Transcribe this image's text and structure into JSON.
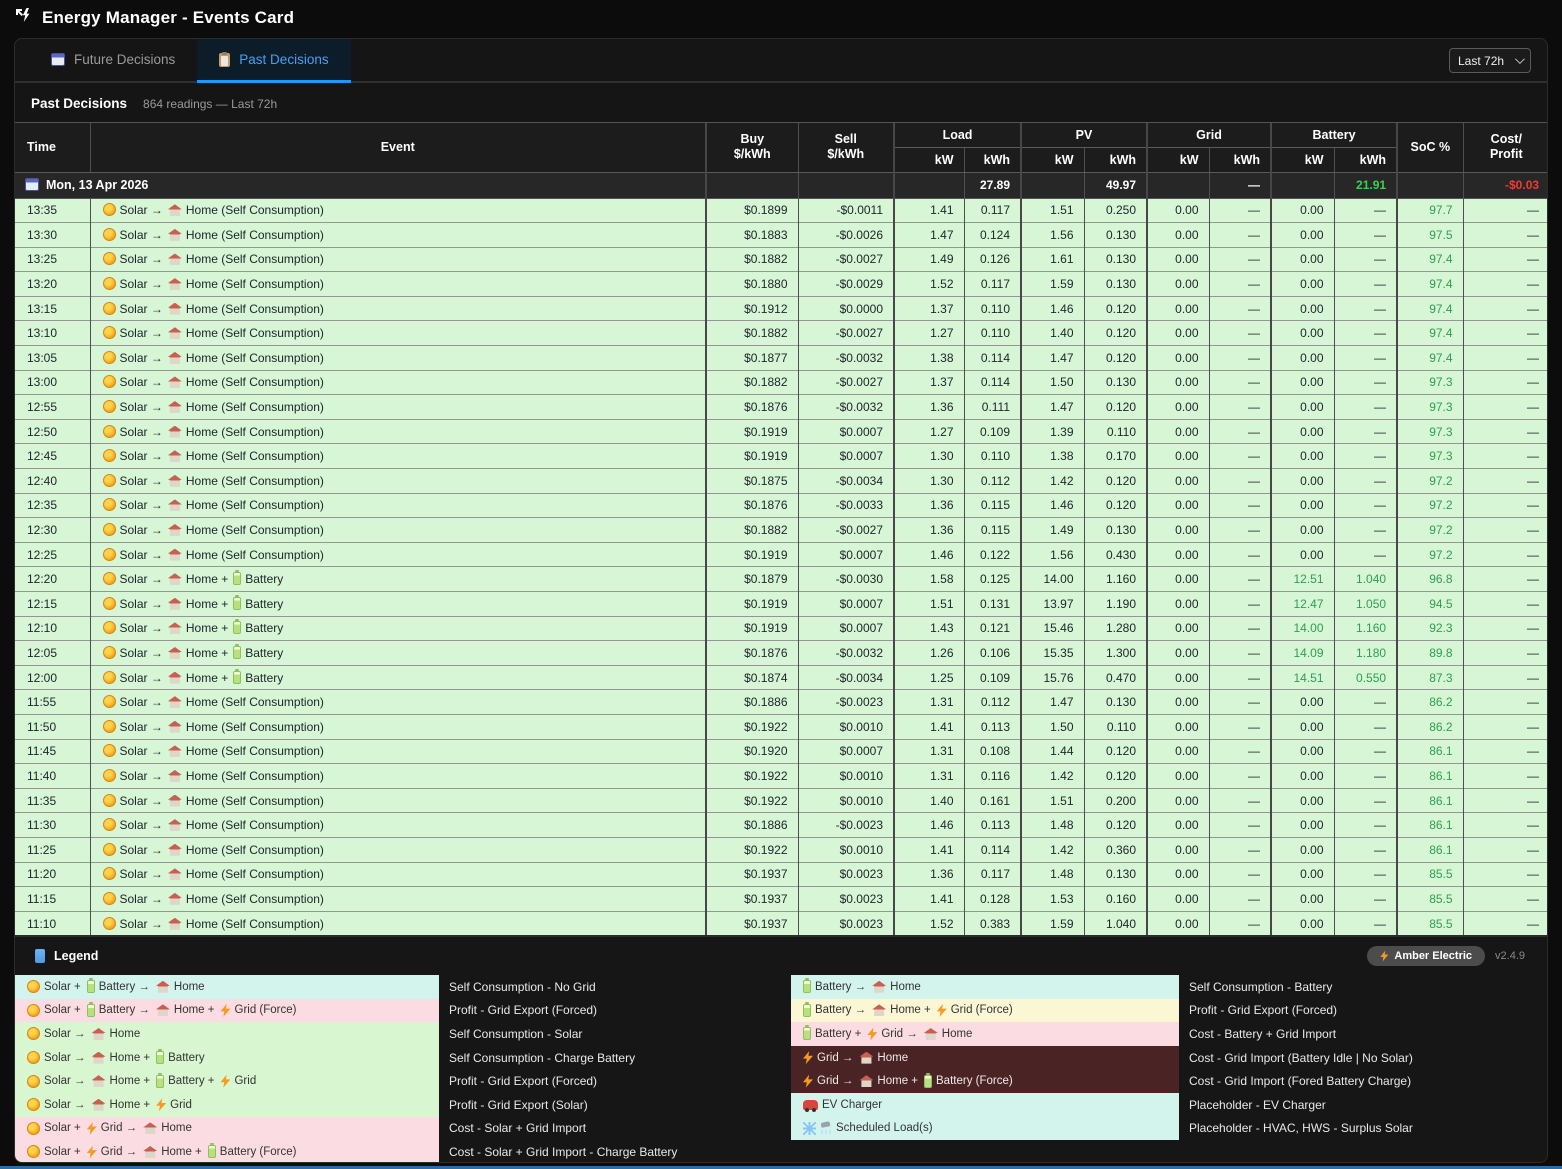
{
  "window": {
    "title": "Energy Manager - Events Card"
  },
  "tabs": [
    {
      "label": "Future Decisions",
      "icon": "calendar-icon",
      "active": false
    },
    {
      "label": "Past Decisions",
      "icon": "clipboard-icon",
      "active": true
    }
  ],
  "range_select": {
    "value": "Last 72h"
  },
  "section": {
    "title": "Past Decisions",
    "subtitle": "864 readings — Last 72h"
  },
  "table": {
    "headers": {
      "time": "Time",
      "event": "Event",
      "buy": "Buy",
      "sell": "Sell",
      "per_kwh": "$/kWh",
      "load": "Load",
      "pv": "PV",
      "grid": "Grid",
      "battery": "Battery",
      "kw": "kW",
      "kwh": "kWh",
      "soc": "SoC %",
      "cost_line1": "Cost/",
      "cost_line2": "Profit"
    },
    "date_row": {
      "date": "Mon, 13 Apr 2026",
      "load_kwh": "27.89",
      "pv_kwh": "49.97",
      "grid_kwh": "—",
      "battery_kwh": "21.91",
      "cost": "-$0.03"
    },
    "event_types": {
      "solar_self": {
        "tokens": [
          [
            "i",
            "sun"
          ],
          [
            "t",
            "Solar →"
          ],
          [
            "i",
            "home"
          ],
          [
            "t",
            "Home (Self Consumption)"
          ]
        ]
      },
      "solar_home_batt": {
        "tokens": [
          [
            "i",
            "sun"
          ],
          [
            "t",
            "Solar →"
          ],
          [
            "i",
            "home"
          ],
          [
            "t",
            "Home +"
          ],
          [
            "i",
            "battery"
          ],
          [
            "t",
            "Battery"
          ]
        ]
      }
    },
    "rows": [
      [
        "13:35",
        "solar_self",
        "$0.1899",
        "-$0.0011",
        "1.41",
        "0.117",
        "1.51",
        "0.250",
        "0.00",
        "—",
        "0.00",
        "—",
        "97.7",
        "—"
      ],
      [
        "13:30",
        "solar_self",
        "$0.1883",
        "-$0.0026",
        "1.47",
        "0.124",
        "1.56",
        "0.130",
        "0.00",
        "—",
        "0.00",
        "—",
        "97.5",
        "—"
      ],
      [
        "13:25",
        "solar_self",
        "$0.1882",
        "-$0.0027",
        "1.49",
        "0.126",
        "1.61",
        "0.130",
        "0.00",
        "—",
        "0.00",
        "—",
        "97.4",
        "—"
      ],
      [
        "13:20",
        "solar_self",
        "$0.1880",
        "-$0.0029",
        "1.52",
        "0.117",
        "1.59",
        "0.130",
        "0.00",
        "—",
        "0.00",
        "—",
        "97.4",
        "—"
      ],
      [
        "13:15",
        "solar_self",
        "$0.1912",
        "$0.0000",
        "1.37",
        "0.110",
        "1.46",
        "0.120",
        "0.00",
        "—",
        "0.00",
        "—",
        "97.4",
        "—"
      ],
      [
        "13:10",
        "solar_self",
        "$0.1882",
        "-$0.0027",
        "1.27",
        "0.110",
        "1.40",
        "0.120",
        "0.00",
        "—",
        "0.00",
        "—",
        "97.4",
        "—"
      ],
      [
        "13:05",
        "solar_self",
        "$0.1877",
        "-$0.0032",
        "1.38",
        "0.114",
        "1.47",
        "0.120",
        "0.00",
        "—",
        "0.00",
        "—",
        "97.4",
        "—"
      ],
      [
        "13:00",
        "solar_self",
        "$0.1882",
        "-$0.0027",
        "1.37",
        "0.114",
        "1.50",
        "0.130",
        "0.00",
        "—",
        "0.00",
        "—",
        "97.3",
        "—"
      ],
      [
        "12:55",
        "solar_self",
        "$0.1876",
        "-$0.0032",
        "1.36",
        "0.111",
        "1.47",
        "0.120",
        "0.00",
        "—",
        "0.00",
        "—",
        "97.3",
        "—"
      ],
      [
        "12:50",
        "solar_self",
        "$0.1919",
        "$0.0007",
        "1.27",
        "0.109",
        "1.39",
        "0.110",
        "0.00",
        "—",
        "0.00",
        "—",
        "97.3",
        "—"
      ],
      [
        "12:45",
        "solar_self",
        "$0.1919",
        "$0.0007",
        "1.30",
        "0.110",
        "1.38",
        "0.170",
        "0.00",
        "—",
        "0.00",
        "—",
        "97.3",
        "—"
      ],
      [
        "12:40",
        "solar_self",
        "$0.1875",
        "-$0.0034",
        "1.30",
        "0.112",
        "1.42",
        "0.120",
        "0.00",
        "—",
        "0.00",
        "—",
        "97.2",
        "—"
      ],
      [
        "12:35",
        "solar_self",
        "$0.1876",
        "-$0.0033",
        "1.36",
        "0.115",
        "1.46",
        "0.120",
        "0.00",
        "—",
        "0.00",
        "—",
        "97.2",
        "—"
      ],
      [
        "12:30",
        "solar_self",
        "$0.1882",
        "-$0.0027",
        "1.36",
        "0.115",
        "1.49",
        "0.130",
        "0.00",
        "—",
        "0.00",
        "—",
        "97.2",
        "—"
      ],
      [
        "12:25",
        "solar_self",
        "$0.1919",
        "$0.0007",
        "1.46",
        "0.122",
        "1.56",
        "0.430",
        "0.00",
        "—",
        "0.00",
        "—",
        "97.2",
        "—"
      ],
      [
        "12:20",
        "solar_home_batt",
        "$0.1879",
        "-$0.0030",
        "1.58",
        "0.125",
        "14.00",
        "1.160",
        "0.00",
        "—",
        "12.51",
        "1.040",
        "96.8",
        "—"
      ],
      [
        "12:15",
        "solar_home_batt",
        "$0.1919",
        "$0.0007",
        "1.51",
        "0.131",
        "13.97",
        "1.190",
        "0.00",
        "—",
        "12.47",
        "1.050",
        "94.5",
        "—"
      ],
      [
        "12:10",
        "solar_home_batt",
        "$0.1919",
        "$0.0007",
        "1.43",
        "0.121",
        "15.46",
        "1.280",
        "0.00",
        "—",
        "14.00",
        "1.160",
        "92.3",
        "—"
      ],
      [
        "12:05",
        "solar_home_batt",
        "$0.1876",
        "-$0.0032",
        "1.26",
        "0.106",
        "15.35",
        "1.300",
        "0.00",
        "—",
        "14.09",
        "1.180",
        "89.8",
        "—"
      ],
      [
        "12:00",
        "solar_home_batt",
        "$0.1874",
        "-$0.0034",
        "1.25",
        "0.109",
        "15.76",
        "0.470",
        "0.00",
        "—",
        "14.51",
        "0.550",
        "87.3",
        "—"
      ],
      [
        "11:55",
        "solar_self",
        "$0.1886",
        "-$0.0023",
        "1.31",
        "0.112",
        "1.47",
        "0.130",
        "0.00",
        "—",
        "0.00",
        "—",
        "86.2",
        "—"
      ],
      [
        "11:50",
        "solar_self",
        "$0.1922",
        "$0.0010",
        "1.41",
        "0.113",
        "1.50",
        "0.110",
        "0.00",
        "—",
        "0.00",
        "—",
        "86.2",
        "—"
      ],
      [
        "11:45",
        "solar_self",
        "$0.1920",
        "$0.0007",
        "1.31",
        "0.108",
        "1.44",
        "0.120",
        "0.00",
        "—",
        "0.00",
        "—",
        "86.1",
        "—"
      ],
      [
        "11:40",
        "solar_self",
        "$0.1922",
        "$0.0010",
        "1.31",
        "0.116",
        "1.42",
        "0.120",
        "0.00",
        "—",
        "0.00",
        "—",
        "86.1",
        "—"
      ],
      [
        "11:35",
        "solar_self",
        "$0.1922",
        "$0.0010",
        "1.40",
        "0.161",
        "1.51",
        "0.200",
        "0.00",
        "—",
        "0.00",
        "—",
        "86.1",
        "—"
      ],
      [
        "11:30",
        "solar_self",
        "$0.1886",
        "-$0.0023",
        "1.46",
        "0.113",
        "1.48",
        "0.120",
        "0.00",
        "—",
        "0.00",
        "—",
        "86.1",
        "—"
      ],
      [
        "11:25",
        "solar_self",
        "$0.1922",
        "$0.0010",
        "1.41",
        "0.114",
        "1.42",
        "0.360",
        "0.00",
        "—",
        "0.00",
        "—",
        "86.1",
        "—"
      ],
      [
        "11:20",
        "solar_self",
        "$0.1937",
        "$0.0023",
        "1.36",
        "0.117",
        "1.48",
        "0.130",
        "0.00",
        "—",
        "0.00",
        "—",
        "85.5",
        "—"
      ],
      [
        "11:15",
        "solar_self",
        "$0.1937",
        "$0.0023",
        "1.41",
        "0.128",
        "1.53",
        "0.160",
        "0.00",
        "—",
        "0.00",
        "—",
        "85.5",
        "—"
      ],
      [
        "11:10",
        "solar_self",
        "$0.1937",
        "$0.0023",
        "1.52",
        "0.383",
        "1.59",
        "1.040",
        "0.00",
        "—",
        "0.00",
        "—",
        "85.5",
        "—"
      ]
    ]
  },
  "legend": {
    "title": "Legend",
    "columns": [
      {
        "items": [
          {
            "color": "cyan",
            "desc": "Self Consumption - No Grid",
            "tokens": [
              [
                "i",
                "sun"
              ],
              [
                "t",
                "Solar +"
              ],
              [
                "i",
                "battery"
              ],
              [
                "t",
                "Battery →"
              ],
              [
                "i",
                "home"
              ],
              [
                "t",
                "Home"
              ]
            ]
          },
          {
            "color": "pink",
            "desc": "Profit - Grid Export (Forced)",
            "tokens": [
              [
                "i",
                "sun"
              ],
              [
                "t",
                "Solar +"
              ],
              [
                "i",
                "battery"
              ],
              [
                "t",
                "Battery →"
              ],
              [
                "i",
                "home"
              ],
              [
                "t",
                "Home +"
              ],
              [
                "i",
                "bolt"
              ],
              [
                "t",
                "Grid (Force)"
              ]
            ]
          },
          {
            "color": "green",
            "desc": "Self Consumption - Solar",
            "tokens": [
              [
                "i",
                "sun"
              ],
              [
                "t",
                "Solar →"
              ],
              [
                "i",
                "home"
              ],
              [
                "t",
                "Home"
              ]
            ]
          },
          {
            "color": "green",
            "desc": "Self Consumption - Charge Battery",
            "tokens": [
              [
                "i",
                "sun"
              ],
              [
                "t",
                "Solar →"
              ],
              [
                "i",
                "home"
              ],
              [
                "t",
                "Home +"
              ],
              [
                "i",
                "battery"
              ],
              [
                "t",
                "Battery"
              ]
            ]
          },
          {
            "color": "green",
            "desc": "Profit - Grid Export (Forced)",
            "tokens": [
              [
                "i",
                "sun"
              ],
              [
                "t",
                "Solar →"
              ],
              [
                "i",
                "home"
              ],
              [
                "t",
                "Home +"
              ],
              [
                "i",
                "battery"
              ],
              [
                "t",
                "Battery +"
              ],
              [
                "i",
                "bolt"
              ],
              [
                "t",
                "Grid"
              ]
            ]
          },
          {
            "color": "green",
            "desc": "Profit - Grid Export (Solar)",
            "tokens": [
              [
                "i",
                "sun"
              ],
              [
                "t",
                "Solar →"
              ],
              [
                "i",
                "home"
              ],
              [
                "t",
                "Home +"
              ],
              [
                "i",
                "bolt"
              ],
              [
                "t",
                "Grid"
              ]
            ]
          },
          {
            "color": "pink",
            "desc": "Cost - Solar + Grid Import",
            "tokens": [
              [
                "i",
                "sun"
              ],
              [
                "t",
                "Solar +"
              ],
              [
                "i",
                "bolt"
              ],
              [
                "t",
                "Grid →"
              ],
              [
                "i",
                "home"
              ],
              [
                "t",
                "Home"
              ]
            ]
          },
          {
            "color": "pink",
            "desc": "Cost - Solar + Grid Import - Charge Battery",
            "tokens": [
              [
                "i",
                "sun"
              ],
              [
                "t",
                "Solar +"
              ],
              [
                "i",
                "bolt"
              ],
              [
                "t",
                "Grid →"
              ],
              [
                "i",
                "home"
              ],
              [
                "t",
                "Home +"
              ],
              [
                "i",
                "battery"
              ],
              [
                "t",
                "Battery (Force)"
              ]
            ]
          }
        ]
      },
      {
        "items": [
          {
            "color": "cyan",
            "desc": "Self Consumption - Battery",
            "tokens": [
              [
                "i",
                "battery"
              ],
              [
                "t",
                "Battery →"
              ],
              [
                "i",
                "home"
              ],
              [
                "t",
                "Home"
              ]
            ]
          },
          {
            "color": "yellow",
            "desc": "Profit - Grid Export (Forced)",
            "tokens": [
              [
                "i",
                "battery"
              ],
              [
                "t",
                "Battery →"
              ],
              [
                "i",
                "home"
              ],
              [
                "t",
                "Home +"
              ],
              [
                "i",
                "bolt"
              ],
              [
                "t",
                "Grid (Force)"
              ]
            ]
          },
          {
            "color": "pink",
            "desc": "Cost - Battery + Grid Import",
            "tokens": [
              [
                "i",
                "battery"
              ],
              [
                "t",
                "Battery +"
              ],
              [
                "i",
                "bolt"
              ],
              [
                "t",
                "Grid →"
              ],
              [
                "i",
                "home"
              ],
              [
                "t",
                "Home"
              ]
            ]
          },
          {
            "color": "maroon",
            "desc": "Cost - Grid Import (Battery Idle | No Solar)",
            "tokens": [
              [
                "i",
                "bolt"
              ],
              [
                "t",
                "Grid →"
              ],
              [
                "i",
                "home"
              ],
              [
                "t",
                "Home"
              ]
            ]
          },
          {
            "color": "maroon",
            "desc": "Cost - Grid Import (Fored Battery Charge)",
            "tokens": [
              [
                "i",
                "bolt"
              ],
              [
                "t",
                "Grid →"
              ],
              [
                "i",
                "home"
              ],
              [
                "t",
                "Home +"
              ],
              [
                "i",
                "battery"
              ],
              [
                "t",
                "Battery (Force)"
              ]
            ]
          },
          {
            "color": "cyan",
            "desc": "Placeholder - EV Charger",
            "tokens": [
              [
                "i",
                "car"
              ],
              [
                "t",
                "EV Charger"
              ]
            ]
          },
          {
            "color": "cyan",
            "desc": "Placeholder - HVAC, HWS - Surplus Solar",
            "tokens": [
              [
                "i",
                "snowflake"
              ],
              [
                "i",
                "shower"
              ],
              [
                "t",
                "Scheduled Load(s)"
              ]
            ]
          }
        ]
      }
    ]
  },
  "footer": {
    "brand": "Amber Electric",
    "version": "v2.4.9"
  },
  "colors": {
    "accent_blue": "#2196f3",
    "row_green": "#d6f6d6",
    "soc_green": "#2f9e4f",
    "cost_red": "#f23b33",
    "maroon_chip": "#4a2424"
  }
}
